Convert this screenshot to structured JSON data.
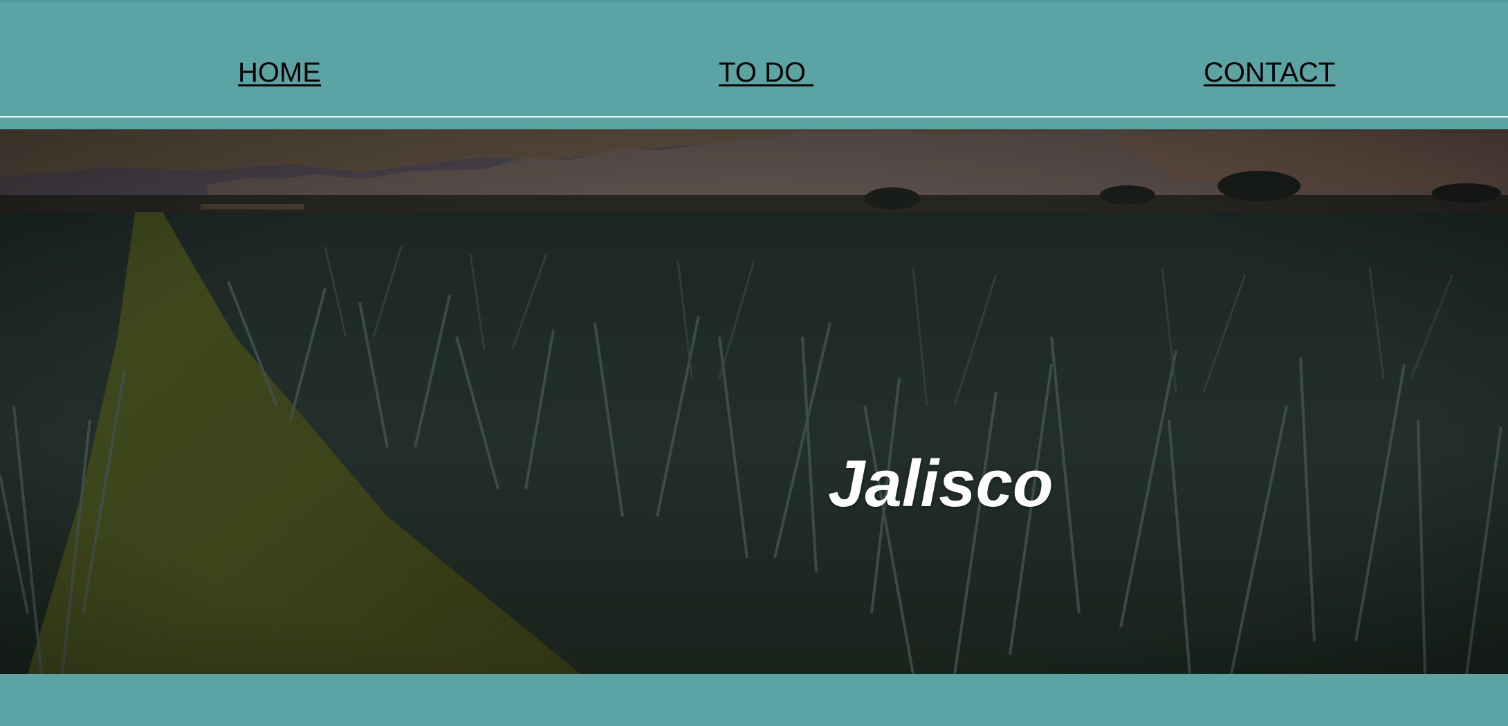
{
  "nav": {
    "links": [
      {
        "label": "HOME"
      },
      {
        "label": "TO DO "
      },
      {
        "label": "CONTACT"
      }
    ]
  },
  "hero": {
    "title": "Jalisco",
    "image": "agave-field-photo"
  },
  "colors": {
    "background": "#5ba4a3",
    "title": "#ffffff",
    "link": "#000000"
  }
}
